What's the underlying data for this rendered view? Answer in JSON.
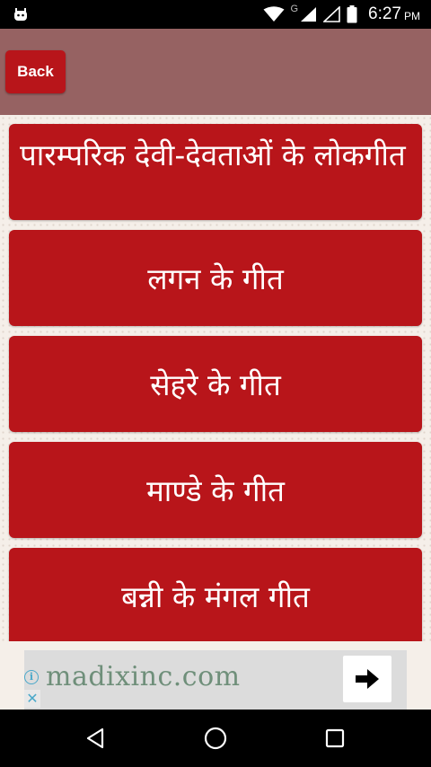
{
  "status_bar": {
    "network_label": "G",
    "time": "6:27",
    "ampm": "PM"
  },
  "header": {
    "back_label": "Back"
  },
  "menu": {
    "items": [
      {
        "label": "पारम्परिक देवी-देवताओं के लोकगीत"
      },
      {
        "label": "लगन के गीत"
      },
      {
        "label": "सेहरे के गीत"
      },
      {
        "label": "माण्डे के गीत"
      },
      {
        "label": "बन्नी के मंगल गीत"
      }
    ]
  },
  "ad": {
    "text": "madixinc.com",
    "info_symbol": "i",
    "close_symbol": "✕"
  },
  "colors": {
    "accent": "#b8151a",
    "header": "#966262",
    "background": "#f5efe9"
  }
}
